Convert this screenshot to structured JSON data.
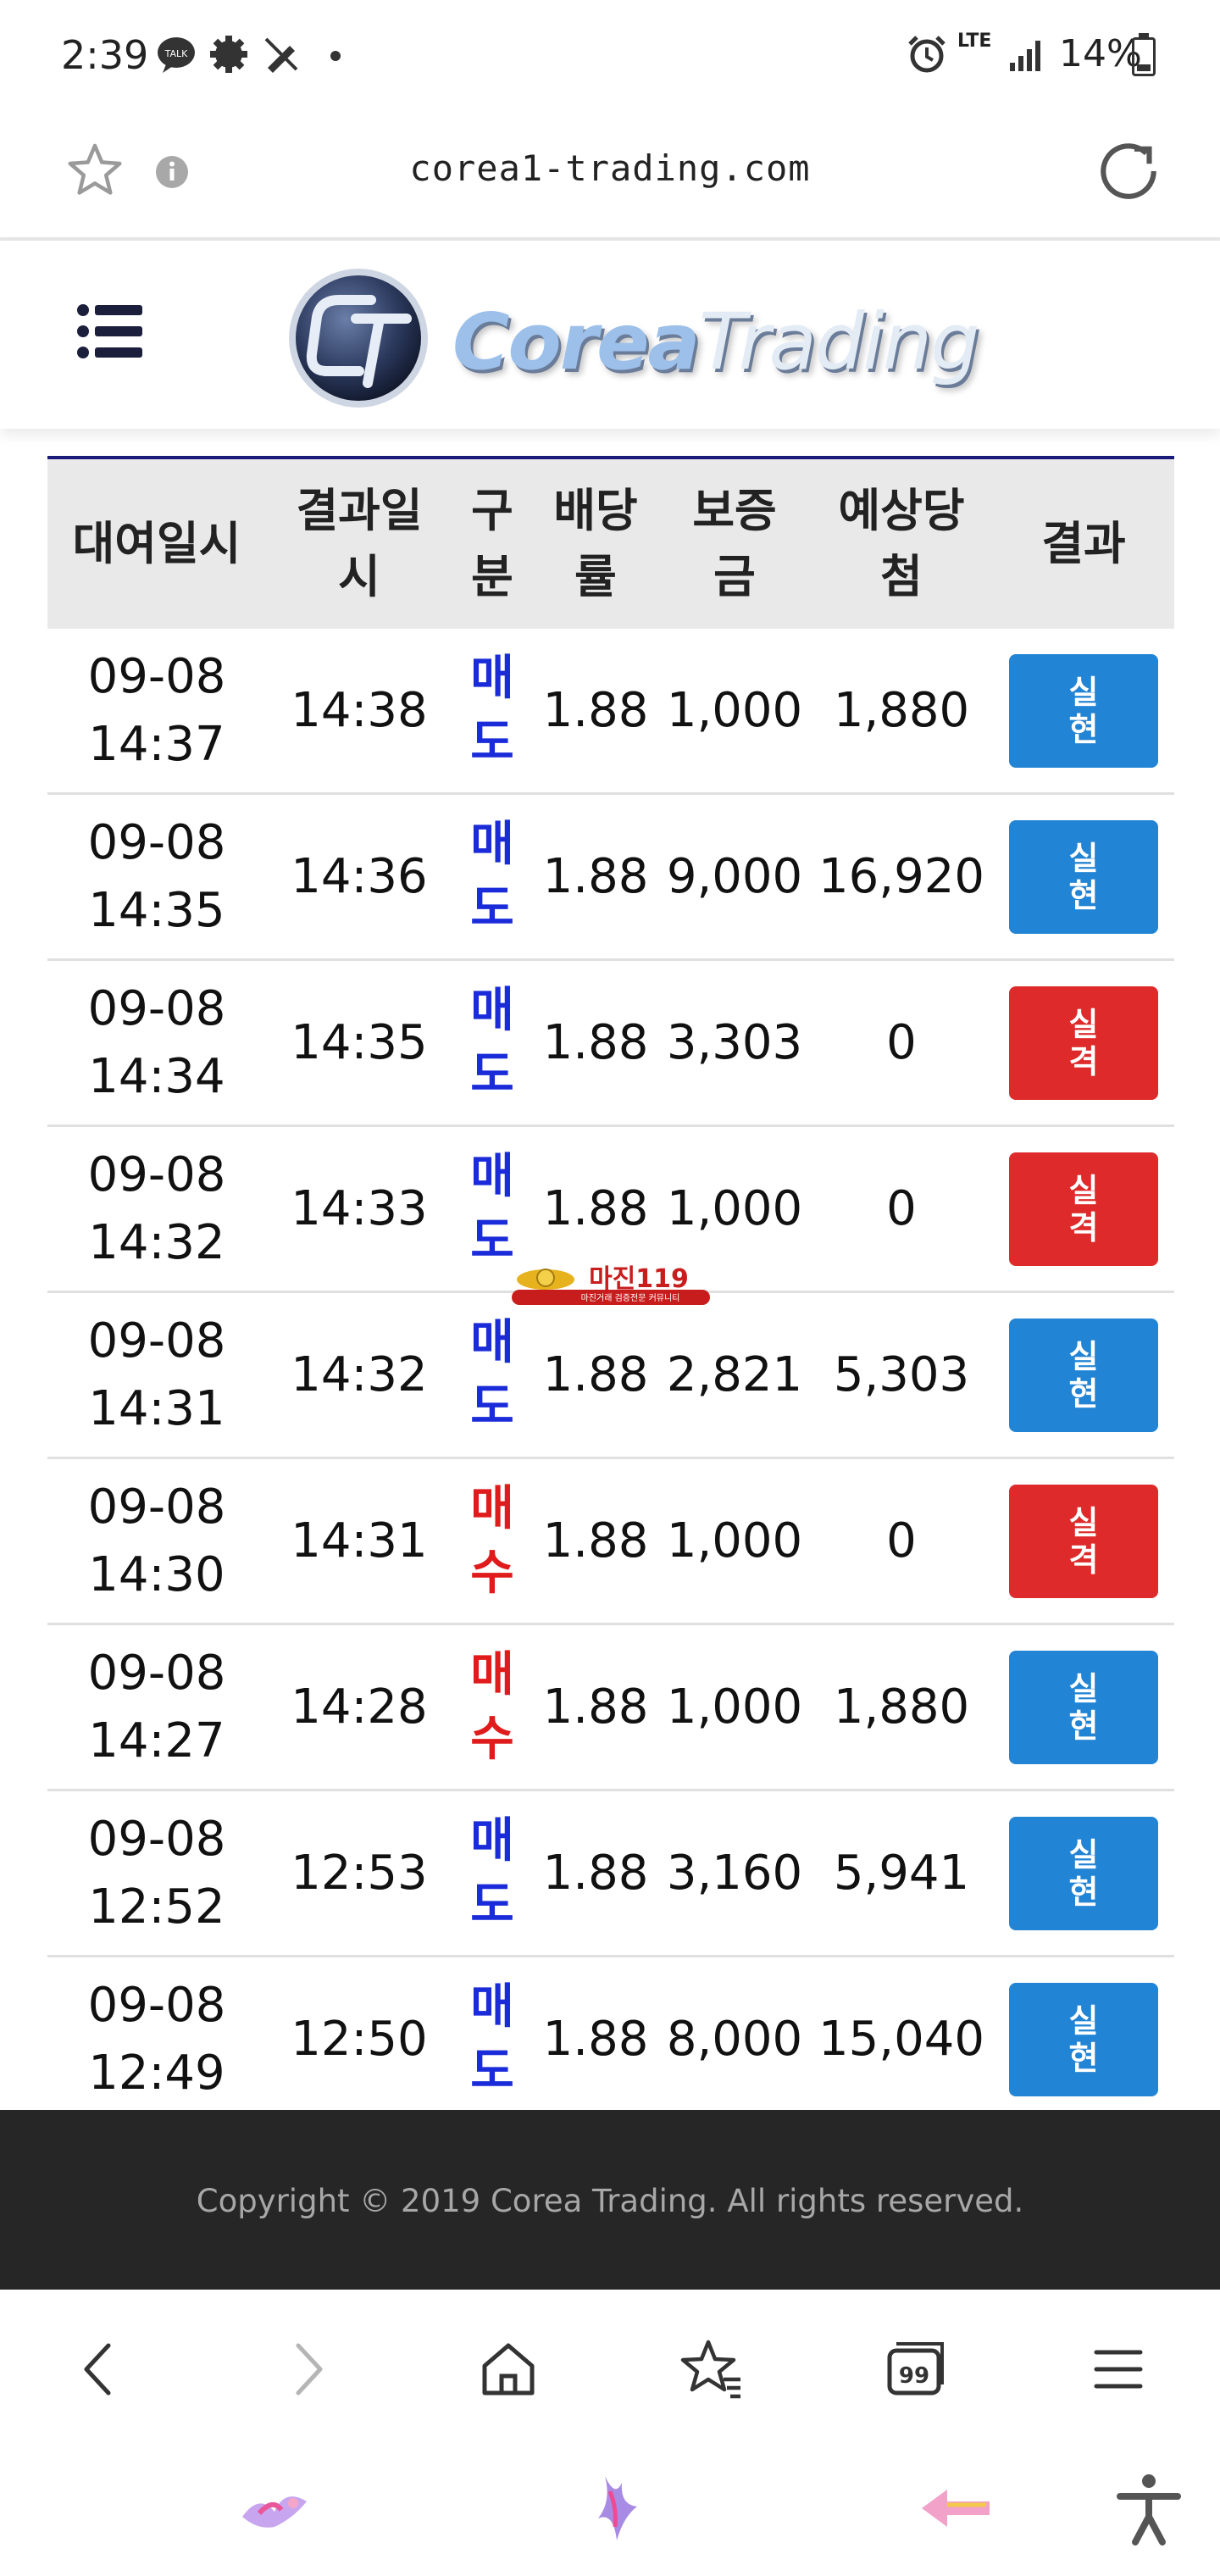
{
  "status_bar": {
    "time": "2:39",
    "network": "LTE",
    "battery": "14%",
    "icons": [
      "talk-icon",
      "settings-gear-icon",
      "no-pen-icon",
      "dot-icon",
      "alarm-icon",
      "signal-icon",
      "battery-icon"
    ]
  },
  "browser": {
    "url": "corea1-trading.com",
    "icons": [
      "star-icon",
      "info-icon",
      "reload-icon"
    ]
  },
  "site": {
    "logo_text_main": "Corea",
    "logo_text_light": "Trading",
    "logo_emblem": "CT"
  },
  "table": {
    "headers": [
      "대여일시",
      "결과일시",
      "구분",
      "배당률",
      "보증금",
      "예상당첨",
      "결과"
    ],
    "header_lines": [
      [
        "대여일시"
      ],
      [
        "결과일",
        "시"
      ],
      [
        "구",
        "분"
      ],
      [
        "배당",
        "률"
      ],
      [
        "보증",
        "금"
      ],
      [
        "예상당",
        "첨"
      ],
      [
        "결과"
      ]
    ],
    "rows": [
      {
        "rent_date": "09-08",
        "rent_time": "14:37",
        "result_time": "14:38",
        "type_1": "매",
        "type_2": "도",
        "type_kind": "sell",
        "rate": "1.88",
        "deposit": "1,000",
        "expected": "1,880",
        "result_1": "실",
        "result_2": "현",
        "result_kind": "win"
      },
      {
        "rent_date": "09-08",
        "rent_time": "14:35",
        "result_time": "14:36",
        "type_1": "매",
        "type_2": "도",
        "type_kind": "sell",
        "rate": "1.88",
        "deposit": "9,000",
        "expected": "16,920",
        "result_1": "실",
        "result_2": "현",
        "result_kind": "win"
      },
      {
        "rent_date": "09-08",
        "rent_time": "14:34",
        "result_time": "14:35",
        "type_1": "매",
        "type_2": "도",
        "type_kind": "sell",
        "rate": "1.88",
        "deposit": "3,303",
        "expected": "0",
        "result_1": "실",
        "result_2": "격",
        "result_kind": "lose"
      },
      {
        "rent_date": "09-08",
        "rent_time": "14:32",
        "result_time": "14:33",
        "type_1": "매",
        "type_2": "도",
        "type_kind": "sell",
        "rate": "1.88",
        "deposit": "1,000",
        "expected": "0",
        "result_1": "실",
        "result_2": "격",
        "result_kind": "lose"
      },
      {
        "rent_date": "09-08",
        "rent_time": "14:31",
        "result_time": "14:32",
        "type_1": "매",
        "type_2": "도",
        "type_kind": "sell",
        "rate": "1.88",
        "deposit": "2,821",
        "expected": "5,303",
        "result_1": "실",
        "result_2": "현",
        "result_kind": "win"
      },
      {
        "rent_date": "09-08",
        "rent_time": "14:30",
        "result_time": "14:31",
        "type_1": "매",
        "type_2": "수",
        "type_kind": "buy",
        "rate": "1.88",
        "deposit": "1,000",
        "expected": "0",
        "result_1": "실",
        "result_2": "격",
        "result_kind": "lose"
      },
      {
        "rent_date": "09-08",
        "rent_time": "14:27",
        "result_time": "14:28",
        "type_1": "매",
        "type_2": "수",
        "type_kind": "buy",
        "rate": "1.88",
        "deposit": "1,000",
        "expected": "1,880",
        "result_1": "실",
        "result_2": "현",
        "result_kind": "win"
      },
      {
        "rent_date": "09-08",
        "rent_time": "12:52",
        "result_time": "12:53",
        "type_1": "매",
        "type_2": "도",
        "type_kind": "sell",
        "rate": "1.88",
        "deposit": "3,160",
        "expected": "5,941",
        "result_1": "실",
        "result_2": "현",
        "result_kind": "win"
      },
      {
        "rent_date": "09-08",
        "rent_time": "12:49",
        "result_time": "12:50",
        "type_1": "매",
        "type_2": "도",
        "type_kind": "sell",
        "rate": "1.88",
        "deposit": "8,000",
        "expected": "15,040",
        "result_1": "실",
        "result_2": "현",
        "result_kind": "win"
      }
    ]
  },
  "watermark": {
    "title": "마진119",
    "subtitle": "마진거래 검증전문 커뮤니티"
  },
  "footer": {
    "copyright": "Copyright © 2019 Corea Trading. All rights reserved."
  },
  "browser_bottom_bar": {
    "icons": [
      "back-icon",
      "forward-icon",
      "home-icon",
      "bookmarks-icon",
      "tabs-icon",
      "menu-icon"
    ],
    "tabs_count": "99"
  },
  "system_nav": {
    "icons": [
      "app-shortcut-icon",
      "app-shortcut-icon-2",
      "back-gesture-icon",
      "accessibility-icon"
    ]
  },
  "colors": {
    "sell": "#1a2bd9",
    "buy": "#e01b1b",
    "win": "#2284d4",
    "lose": "#de2a2a",
    "header_border": "#1a1a7a",
    "footer_bg": "#262626"
  }
}
